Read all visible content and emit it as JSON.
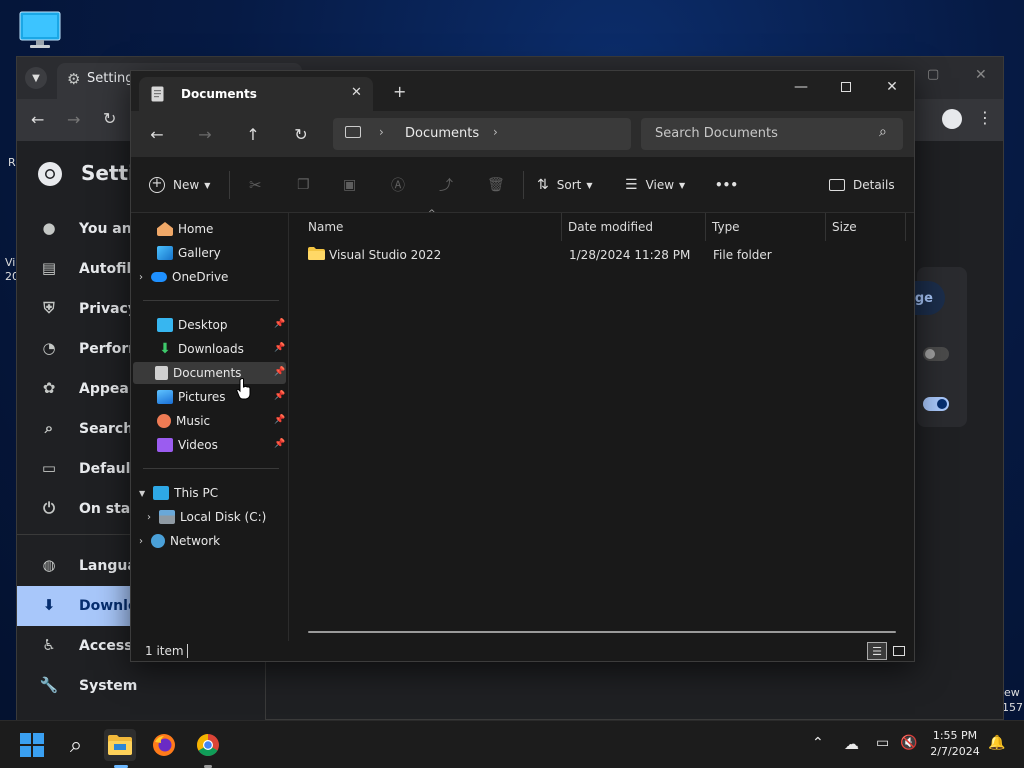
{
  "desktop": {
    "left_fragment_1": "R",
    "left_fragment_2": "Vi",
    "left_fragment_3": "20",
    "right_fragment_1": "ew",
    "right_fragment_2": "157"
  },
  "chrome": {
    "tab_title": "Settings",
    "sidebar_title": "Setti",
    "nav_items": [
      {
        "label": "You and",
        "icon": "person-icon"
      },
      {
        "label": "Autofill",
        "icon": "clipboard-icon"
      },
      {
        "label": "Privacy a",
        "icon": "shield-icon"
      },
      {
        "label": "Perform",
        "icon": "speedometer-icon"
      },
      {
        "label": "Appeara",
        "icon": "palette-icon"
      },
      {
        "label": "Search e",
        "icon": "search-icon"
      },
      {
        "label": "Default",
        "icon": "browser-icon"
      },
      {
        "label": "On start",
        "icon": "power-icon"
      },
      {
        "label": "Languag",
        "icon": "globe-icon"
      },
      {
        "label": "Downlo",
        "icon": "download-icon"
      },
      {
        "label": "Accessil",
        "icon": "accessibility-icon"
      },
      {
        "label": "System",
        "icon": "wrench-icon"
      }
    ],
    "card_button_fragment": "ge",
    "accent": "#a8c7fa"
  },
  "explorer": {
    "tab_title": "Documents",
    "new_tab_symbol": "+",
    "address_current": "Documents",
    "search_placeholder": "Search Documents",
    "cmd": {
      "new": "New",
      "sort": "Sort",
      "view": "View",
      "more": "•••",
      "details": "Details"
    },
    "nav": {
      "home": "Home",
      "gallery": "Gallery",
      "onedrive": "OneDrive",
      "desktop": "Desktop",
      "downloads": "Downloads",
      "documents": "Documents",
      "pictures": "Pictures",
      "music": "Music",
      "videos": "Videos",
      "thispc": "This PC",
      "localdisk": "Local Disk (C:)",
      "network": "Network"
    },
    "columns": {
      "name": "Name",
      "date": "Date modified",
      "type": "Type",
      "size": "Size"
    },
    "files": [
      {
        "name": "Visual Studio 2022",
        "date": "1/28/2024 11:28 PM",
        "type": "File folder",
        "size": ""
      }
    ],
    "status": "1 item"
  },
  "taskbar": {
    "time": "1:55 PM",
    "date": "2/7/2024"
  }
}
